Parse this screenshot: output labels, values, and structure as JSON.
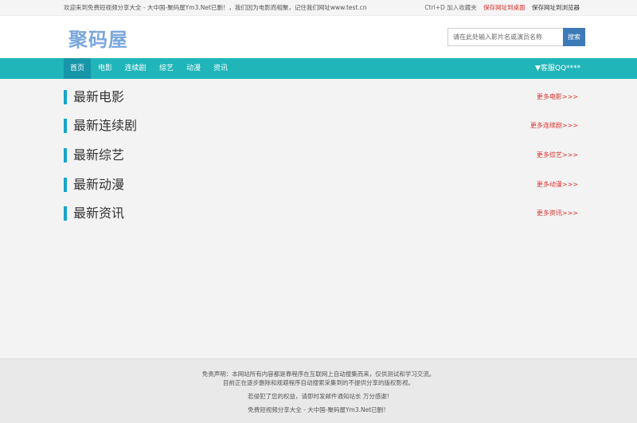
{
  "topbar": {
    "welcome": "欢迎来到免费短视频分享大全 - 大中国-聚码屋Ym3.Net已删！，我们因为电影而相聚，记住我们网址www.test.cn",
    "bookmark_hint": "Ctrl+D 加入收藏夹",
    "save_desktop": "保存网址到桌面",
    "save_browser": "保存网址到浏览器"
  },
  "header": {
    "logo": "聚码屋",
    "search_placeholder": "请在此处输入影片名或演员名称",
    "search_button": "搜索"
  },
  "nav": {
    "items": [
      "首页",
      "电影",
      "连续剧",
      "综艺",
      "动漫",
      "资讯"
    ],
    "active_index": 0,
    "qq": "▼客服QQ****"
  },
  "sections": [
    {
      "title": "最新电影",
      "more": "更多电影>>>"
    },
    {
      "title": "最新连续剧",
      "more": "更多连续剧>>>"
    },
    {
      "title": "最新综艺",
      "more": "更多综艺>>>"
    },
    {
      "title": "最新动漫",
      "more": "更多动漫>>>"
    },
    {
      "title": "最新资讯",
      "more": "更多资讯>>>"
    }
  ],
  "footer": {
    "line1": "免责声明：本网站所有内容都是靠程序在互联网上自动搜集而来，仅供测试和学习交流。",
    "line2": "目前正在逐步删除和规避程序自动搜索采集到的不提供分享的版权影视。",
    "line3": "若侵犯了您的权益，请即时发邮件通知站长 万分感谢!",
    "line4": "免费短视频分享大全 - 大中国-聚码屋Ym3.Net已删！"
  },
  "colors": {
    "nav_bg": "#1fb5b9",
    "nav_active": "#1795a9",
    "accent_bar": "#17a5c6",
    "more_link": "#d9302c",
    "logo": "#7aa7dc",
    "search_button": "#3d7ab8"
  }
}
